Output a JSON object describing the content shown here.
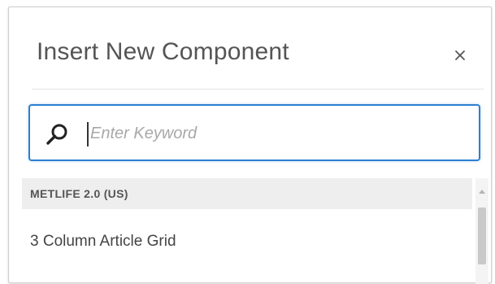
{
  "dialog": {
    "title": "Insert New Component",
    "close_label": "×"
  },
  "search": {
    "placeholder": "Enter Keyword",
    "value": ""
  },
  "list": {
    "groups": [
      {
        "label": "METLIFE 2.0 (US)",
        "items": [
          {
            "label": "3 Column Article Grid"
          }
        ]
      }
    ]
  },
  "colors": {
    "accent": "#2d7fd1",
    "title_text": "#555555",
    "group_header_bg": "#eeeeee"
  },
  "icons": {
    "search": "search-icon",
    "close": "close-icon"
  }
}
